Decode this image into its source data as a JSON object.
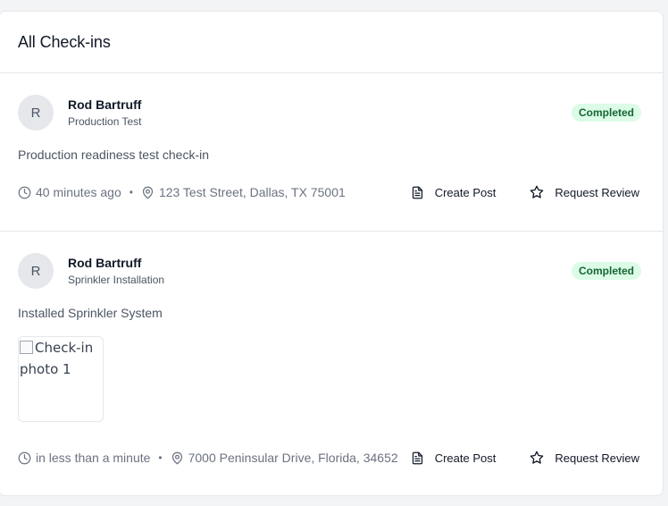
{
  "header": {
    "title": "All Check-ins"
  },
  "checkins": [
    {
      "avatar_initial": "R",
      "user_name": "Rod Bartruff",
      "category": "Production Test",
      "status": "Completed",
      "description": "Production readiness test check-in",
      "time": "40 minutes ago",
      "separator": "•",
      "address": "123 Test Street, Dallas, TX 75001",
      "create_post_label": "Create Post",
      "request_review_label": "Request Review"
    },
    {
      "avatar_initial": "R",
      "user_name": "Rod Bartruff",
      "category": "Sprinkler Installation",
      "status": "Completed",
      "description": "Installed Sprinkler System",
      "photo_alt": "Check-in photo 1",
      "time": "in less than a minute",
      "separator": "•",
      "address": "7000 Peninsular Drive, Florida, 34652",
      "create_post_label": "Create Post",
      "request_review_label": "Request Review"
    }
  ],
  "icons": {
    "time": "clock-icon",
    "location": "map-pin-icon",
    "create_post": "document-icon",
    "request_review": "star-icon"
  },
  "colors": {
    "badge_bg": "#dcfce7",
    "badge_text": "#166534",
    "muted_text": "#6b7280",
    "border": "#e5e7eb"
  }
}
